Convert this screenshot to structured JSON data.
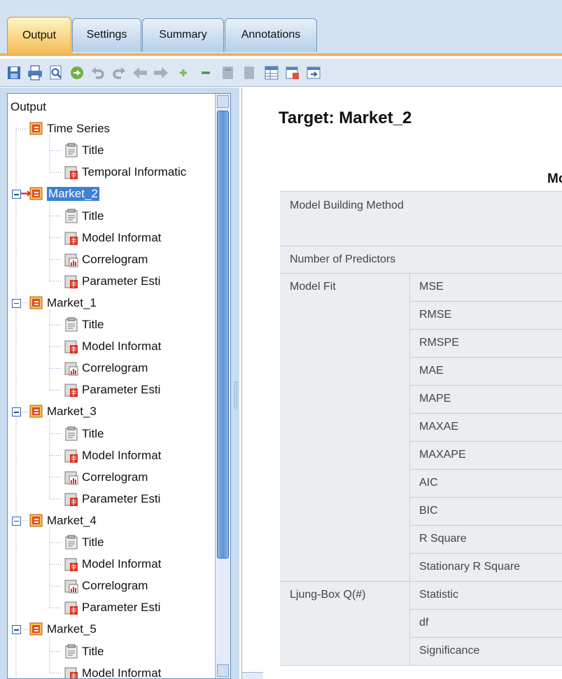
{
  "tabs": [
    {
      "label": "Output",
      "active": true
    },
    {
      "label": "Settings",
      "active": false
    },
    {
      "label": "Summary",
      "active": false
    },
    {
      "label": "Annotations",
      "active": false
    }
  ],
  "toolbar": {
    "icons": [
      "save-icon",
      "print-icon",
      "preview-icon",
      "export-icon",
      "undo-icon",
      "redo-icon",
      "back-icon",
      "forward-icon",
      "expand-icon",
      "collapse-icon",
      "copy-icon",
      "paste-icon",
      "table-icon",
      "chart-export-icon",
      "web-export-icon"
    ]
  },
  "tree": {
    "root": "Output",
    "series_label": "Time Series",
    "top_items": [
      "Title",
      "Temporal Informatic"
    ],
    "markets": [
      {
        "label": "Market_2",
        "selected": true,
        "children": [
          "Title",
          "Model Informat",
          "Correlogram",
          "Parameter Esti"
        ]
      },
      {
        "label": "Market_1",
        "selected": false,
        "children": [
          "Title",
          "Model Informat",
          "Correlogram",
          "Parameter Esti"
        ]
      },
      {
        "label": "Market_3",
        "selected": false,
        "children": [
          "Title",
          "Model Informat",
          "Correlogram",
          "Parameter Esti"
        ]
      },
      {
        "label": "Market_4",
        "selected": false,
        "children": [
          "Title",
          "Model Informat",
          "Correlogram",
          "Parameter Esti"
        ]
      },
      {
        "label": "Market_5",
        "selected": false,
        "children": [
          "Title",
          "Model Informat"
        ]
      }
    ]
  },
  "content": {
    "target_title": "Target: Market_2",
    "table_caption": "Mo",
    "rows": [
      {
        "group": "Model Building Method",
        "stat": ""
      },
      {
        "group": "Number of Predictors",
        "stat": ""
      },
      {
        "group": "Model Fit",
        "stat": "MSE"
      },
      {
        "group": "",
        "stat": "RMSE"
      },
      {
        "group": "",
        "stat": "RMSPE"
      },
      {
        "group": "",
        "stat": "MAE"
      },
      {
        "group": "",
        "stat": "MAPE"
      },
      {
        "group": "",
        "stat": "MAXAE"
      },
      {
        "group": "",
        "stat": "MAXAPE"
      },
      {
        "group": "",
        "stat": "AIC"
      },
      {
        "group": "",
        "stat": "BIC"
      },
      {
        "group": "",
        "stat": "R Square"
      },
      {
        "group": "",
        "stat": "Stationary R Square"
      },
      {
        "group": "Ljung-Box Q(#)",
        "stat": "Statistic"
      },
      {
        "group": "",
        "stat": "df"
      },
      {
        "group": "",
        "stat": "Significance"
      }
    ]
  },
  "colors": {
    "active_tab": "#f3bd55",
    "tab_underline": "#f0b45b",
    "selection": "#3d7fd4",
    "scroll_thumb": "#5e93d2",
    "table_header_bg": "#eaeef1"
  }
}
